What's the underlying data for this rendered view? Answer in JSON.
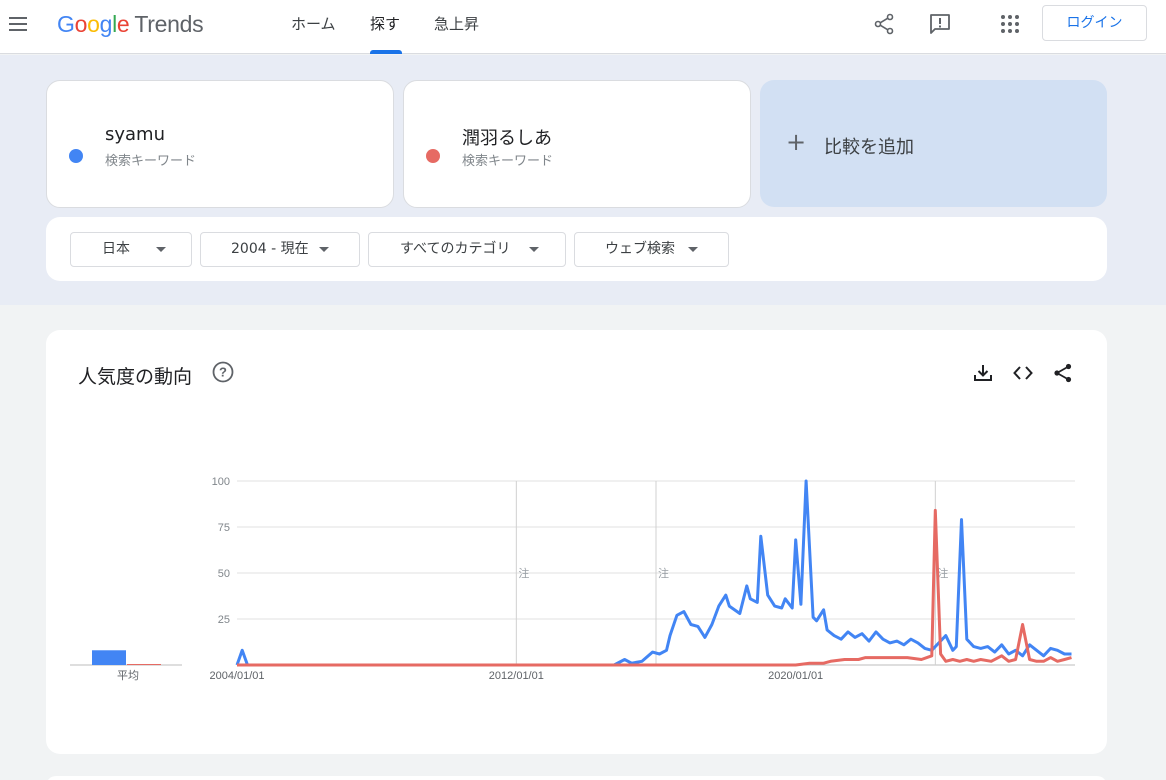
{
  "header": {
    "logo_google": "Google",
    "logo_trends": "Trends",
    "tabs": [
      {
        "label": "ホーム"
      },
      {
        "label": "探す"
      },
      {
        "label": "急上昇"
      }
    ],
    "login_label": "ログイン"
  },
  "terms": [
    {
      "name": "syamu",
      "type": "検索キーワード",
      "color": "#4285f4"
    },
    {
      "name": "潤羽るしあ",
      "type": "検索キーワード",
      "color": "#e66a63"
    }
  ],
  "add_compare": {
    "plus": "+",
    "label": "比較を追加"
  },
  "filters": {
    "region": "日本",
    "period": "2004 - 現在",
    "category": "すべてのカテゴリ",
    "property": "ウェブ検索"
  },
  "section": {
    "title": "人気度の動向",
    "help": "?"
  },
  "chart_data": {
    "type": "line",
    "title": "",
    "xlabel": "",
    "ylabel": "",
    "ylim": [
      0,
      100
    ],
    "yticks": [
      "100",
      "75",
      "50",
      "25"
    ],
    "xtick_labels": [
      "2004/01/01",
      "2012/01/01",
      "2020/01/01"
    ],
    "note_marker": "注",
    "average_label": "平均",
    "average_values": [
      8,
      0
    ],
    "grid": true,
    "legend": "none",
    "series": [
      {
        "term": "syamu",
        "color": "#4285f4",
        "points": [
          [
            2004.0,
            0
          ],
          [
            2004.15,
            8
          ],
          [
            2004.3,
            0
          ],
          [
            2008.0,
            0
          ],
          [
            2012.0,
            0
          ],
          [
            2014.8,
            0
          ],
          [
            2015.1,
            3
          ],
          [
            2015.3,
            1
          ],
          [
            2015.6,
            2
          ],
          [
            2015.9,
            7
          ],
          [
            2016.1,
            6
          ],
          [
            2016.3,
            8
          ],
          [
            2016.4,
            16
          ],
          [
            2016.6,
            27
          ],
          [
            2016.8,
            29
          ],
          [
            2017.0,
            22
          ],
          [
            2017.2,
            21
          ],
          [
            2017.4,
            15
          ],
          [
            2017.6,
            22
          ],
          [
            2017.8,
            32
          ],
          [
            2018.0,
            38
          ],
          [
            2018.1,
            32
          ],
          [
            2018.4,
            28
          ],
          [
            2018.6,
            43
          ],
          [
            2018.7,
            36
          ],
          [
            2018.9,
            34
          ],
          [
            2019.0,
            70
          ],
          [
            2019.2,
            38
          ],
          [
            2019.4,
            32
          ],
          [
            2019.6,
            31
          ],
          [
            2019.7,
            36
          ],
          [
            2019.9,
            31
          ],
          [
            2020.0,
            68
          ],
          [
            2020.15,
            33
          ],
          [
            2020.3,
            100
          ],
          [
            2020.5,
            26
          ],
          [
            2020.6,
            24
          ],
          [
            2020.8,
            30
          ],
          [
            2020.9,
            19
          ],
          [
            2021.1,
            16
          ],
          [
            2021.3,
            14
          ],
          [
            2021.5,
            18
          ],
          [
            2021.7,
            15
          ],
          [
            2021.9,
            17
          ],
          [
            2022.1,
            13
          ],
          [
            2022.3,
            18
          ],
          [
            2022.5,
            14
          ],
          [
            2022.7,
            12
          ],
          [
            2022.9,
            13
          ],
          [
            2023.1,
            11
          ],
          [
            2023.3,
            14
          ],
          [
            2023.5,
            12
          ],
          [
            2023.7,
            9
          ],
          [
            2023.9,
            8
          ],
          [
            2024.1,
            12
          ],
          [
            2024.3,
            16
          ],
          [
            2024.5,
            8
          ],
          [
            2024.6,
            10
          ],
          [
            2024.75,
            79
          ],
          [
            2024.9,
            14
          ],
          [
            2025.1,
            10
          ],
          [
            2025.3,
            9
          ],
          [
            2025.5,
            10
          ],
          [
            2025.7,
            7
          ],
          [
            2025.9,
            11
          ],
          [
            2026.1,
            6
          ],
          [
            2026.3,
            8
          ],
          [
            2026.5,
            5
          ],
          [
            2026.7,
            11
          ],
          [
            2026.9,
            8
          ],
          [
            2027.1,
            5
          ],
          [
            2027.3,
            9
          ],
          [
            2027.5,
            8
          ],
          [
            2027.7,
            6
          ],
          [
            2027.9,
            6
          ]
        ]
      },
      {
        "term": "潤羽るしあ",
        "color": "#e66a63",
        "points": [
          [
            2004.0,
            0
          ],
          [
            2020.0,
            0
          ],
          [
            2020.4,
            1
          ],
          [
            2020.8,
            1
          ],
          [
            2021.0,
            2
          ],
          [
            2021.4,
            3
          ],
          [
            2021.8,
            3
          ],
          [
            2022.0,
            4
          ],
          [
            2022.6,
            4
          ],
          [
            2023.2,
            4
          ],
          [
            2023.6,
            3
          ],
          [
            2023.9,
            5
          ],
          [
            2024.0,
            84
          ],
          [
            2024.15,
            6
          ],
          [
            2024.3,
            2
          ],
          [
            2024.5,
            3
          ],
          [
            2024.7,
            2
          ],
          [
            2024.9,
            3
          ],
          [
            2025.1,
            2
          ],
          [
            2025.3,
            3
          ],
          [
            2025.6,
            2
          ],
          [
            2025.9,
            5
          ],
          [
            2026.1,
            2
          ],
          [
            2026.3,
            3
          ],
          [
            2026.5,
            22
          ],
          [
            2026.7,
            3
          ],
          [
            2026.9,
            2
          ],
          [
            2027.1,
            2
          ],
          [
            2027.3,
            4
          ],
          [
            2027.5,
            2
          ],
          [
            2027.7,
            3
          ],
          [
            2027.9,
            4
          ]
        ]
      }
    ]
  }
}
